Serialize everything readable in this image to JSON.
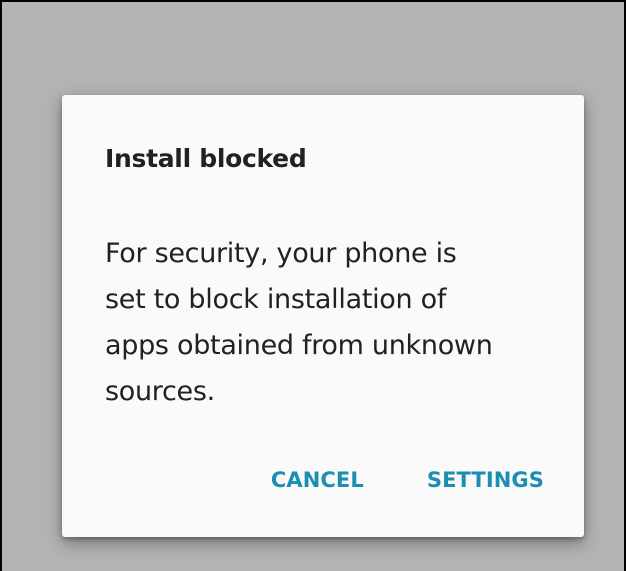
{
  "dialog": {
    "title": "Install blocked",
    "message_lines": [
      "For security, your phone is",
      "set to block installation of",
      "apps obtained from unknown",
      "sources."
    ],
    "buttons": {
      "cancel": "CANCEL",
      "settings": "SETTINGS"
    }
  },
  "colors": {
    "scrim": "#b3b3b3",
    "dialog_bg": "#fafafa",
    "text": "#212121",
    "accent": "#1b8eb1"
  }
}
